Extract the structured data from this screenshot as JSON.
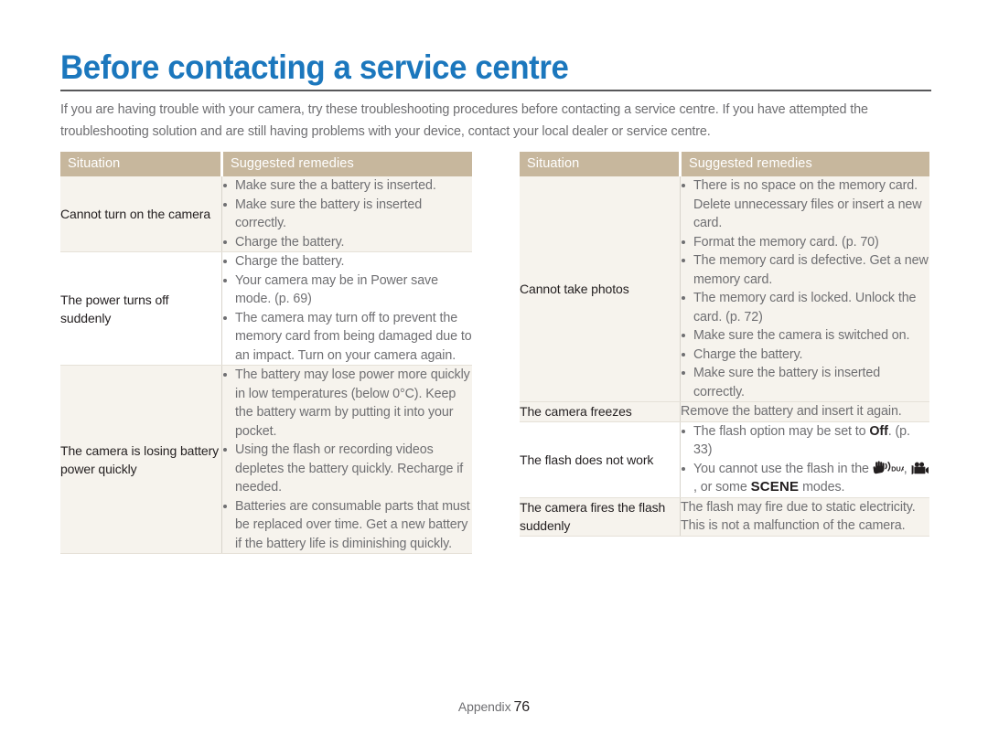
{
  "document": {
    "title": "Before contacting a service centre",
    "intro": "If you are having trouble with your camera, try these troubleshooting procedures before contacting a service centre. If you have attempted the troubleshooting solution and are still having problems with your device, contact your local dealer or service centre.",
    "accent_color": "#1b77bd",
    "header_color": "#c7b79d",
    "shade_color": "#f6f3ed",
    "body_text_color": "#6f6f72"
  },
  "tables": {
    "left": {
      "headers": [
        "Situation",
        "Suggested remedies"
      ],
      "rows": [
        {
          "situation": "Cannot turn on the camera",
          "shaded": true,
          "remedies": [
            "Make sure the a battery is inserted.",
            "Make sure the battery is inserted correctly.",
            "Charge the battery."
          ]
        },
        {
          "situation": "The power turns off suddenly",
          "shaded": false,
          "remedies": [
            "Charge the battery.",
            "Your camera may be in Power save mode. (p. 69)",
            "The camera may turn off to prevent the memory card from being damaged due to an impact. Turn on your camera again."
          ]
        },
        {
          "situation": "The camera is losing battery power quickly",
          "shaded": true,
          "remedies": [
            "The battery may lose power more quickly in low temperatures (below 0°C). Keep the battery warm by putting it into your pocket.",
            "Using the flash or recording videos depletes the battery quickly. Recharge if needed.",
            "Batteries are consumable parts that must be replaced over time. Get a new battery if the battery life is diminishing quickly."
          ]
        }
      ]
    },
    "right": {
      "headers": [
        "Situation",
        "Suggested remedies"
      ],
      "rows": [
        {
          "situation": "Cannot take photos",
          "shaded": true,
          "remedies": [
            "There is no space on the memory card. Delete unnecessary files or insert a new card.",
            "Format the memory card. (p. 70)",
            "The memory card is defective. Get a new memory card.",
            "The memory card is locked. Unlock the card. (p. 72)",
            "Make sure the camera is switched on.",
            "Charge the battery.",
            "Make sure the battery is inserted correctly."
          ]
        },
        {
          "situation": "The camera freezes",
          "shaded": false,
          "plain_remedy": "Remove the battery and insert it again."
        },
        {
          "situation": "The flash does not work",
          "shaded": false,
          "remedies_rich": [
            {
              "parts": [
                {
                  "t": "text",
                  "v": "The flash option may be set to "
                },
                {
                  "t": "bold",
                  "v": "Off"
                },
                {
                  "t": "text",
                  "v": ". (p. 33)"
                }
              ]
            },
            {
              "parts": [
                {
                  "t": "text",
                  "v": "You cannot use the flash in the "
                },
                {
                  "t": "icon",
                  "v": "dual-is-icon"
                },
                {
                  "t": "text",
                  "v": ", "
                },
                {
                  "t": "icon",
                  "v": "movie-camera-icon"
                },
                {
                  "t": "text",
                  "v": ", or some "
                },
                {
                  "t": "scene",
                  "v": "SCENE"
                },
                {
                  "t": "text",
                  "v": " modes."
                }
              ]
            }
          ]
        },
        {
          "situation": "The camera fires the flash suddenly",
          "shaded": true,
          "plain_remedy": "The flash may fire due to static electricity. This is not a malfunction of the camera."
        }
      ]
    }
  },
  "footer": {
    "label": "Appendix",
    "page_number": "76"
  }
}
